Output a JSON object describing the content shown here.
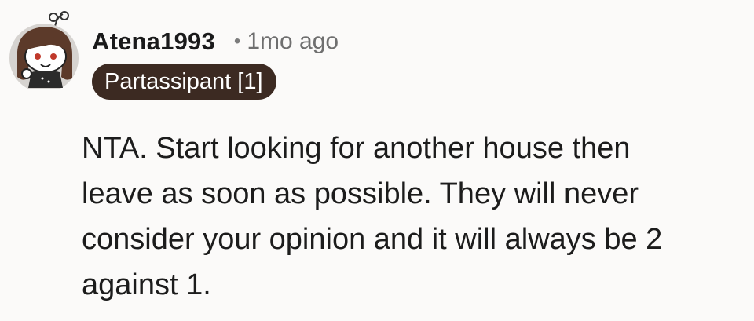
{
  "comment": {
    "avatar_icon": "snoo-avatar-icon",
    "username": "Atena1993",
    "separator": "•",
    "timestamp": "1mo ago",
    "flair": "Partassipant [1]",
    "body_lines": [
      "NTA. Start looking for another house then",
      "leave as soon as possible. They will never",
      "consider your opinion and it will always be 2",
      "against 1."
    ],
    "colors": {
      "background": "#fbfaf9",
      "flair_bg": "#3c2a22",
      "flair_text": "#ffffff",
      "timestamp": "#6f6f6f"
    }
  }
}
